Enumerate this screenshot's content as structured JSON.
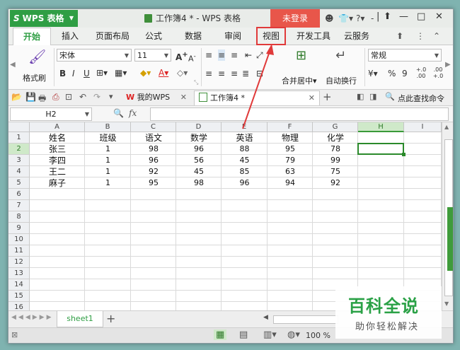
{
  "app": {
    "name": "WPS 表格",
    "doc_title": "工作簿4 * - WPS 表格",
    "login_label": "未登录"
  },
  "menu": {
    "tabs": [
      "开始",
      "插入",
      "页面布局",
      "公式",
      "数据",
      "审阅",
      "视图",
      "开发工具",
      "云服务"
    ],
    "active": "开始",
    "highlighted": "视图"
  },
  "ribbon": {
    "format_painter": "格式刷",
    "font_name": "宋体",
    "font_size": "11",
    "bold": "B",
    "italic": "I",
    "underline": "U",
    "merge_center": "合并居中",
    "wrap_text": "自动换行",
    "number_format": "常规",
    "percent": "%",
    "thousands": "9",
    "inc_decimal": "+.0 .00",
    "dec_decimal": ".00 +.0",
    "currency": "¥",
    "grow_font": "A",
    "shrink_font": "A"
  },
  "quickbar": {
    "doc_tabs": [
      {
        "label": "我的WPS"
      },
      {
        "label": "工作簿4 *"
      }
    ],
    "search": "点此查找命令"
  },
  "formula_bar": {
    "name_box": "H2",
    "fx": "fx",
    "value": ""
  },
  "sheet": {
    "columns": [
      "A",
      "B",
      "C",
      "D",
      "E",
      "F",
      "G",
      "H",
      "I"
    ],
    "row_numbers": [
      "1",
      "2",
      "3",
      "4",
      "5",
      "6",
      "7",
      "8",
      "9",
      "10",
      "11",
      "12",
      "13",
      "14",
      "15",
      "16"
    ],
    "selected_cell": "H2",
    "header_row": [
      "姓名",
      "班级",
      "语文",
      "数学",
      "英语",
      "物理",
      "化学"
    ],
    "rows": [
      [
        "张三",
        "1",
        "98",
        "96",
        "88",
        "95",
        "78"
      ],
      [
        "李四",
        "1",
        "96",
        "56",
        "45",
        "79",
        "99"
      ],
      [
        "王二",
        "1",
        "92",
        "45",
        "85",
        "63",
        "75"
      ],
      [
        "麻子",
        "1",
        "95",
        "98",
        "96",
        "94",
        "92"
      ]
    ]
  },
  "sheetbar": {
    "sheet_name": "sheet1",
    "add": "+"
  },
  "status": {
    "zoom": "100 %"
  },
  "watermark": {
    "logo": "百科全说",
    "tagline": "助你轻松解决"
  },
  "colors": {
    "wps_green": "#2f9e44",
    "login_red": "#e8564a",
    "highlight_red": "#e03a3a"
  }
}
